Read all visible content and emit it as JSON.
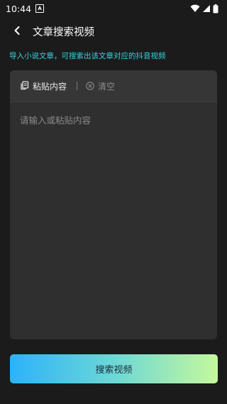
{
  "status_bar": {
    "time": "10:44",
    "notification_badge": "A",
    "icons": [
      "wifi-icon",
      "signal-icon",
      "battery-icon"
    ]
  },
  "header": {
    "back_icon": "chevron-left-icon",
    "title": "文章搜索视频"
  },
  "hint": "导入小说文章，可搜索出该文章对应的抖音视频",
  "toolbar": {
    "paste_icon": "copy-icon",
    "paste_label": "粘贴内容",
    "clear_icon": "close-circle-icon",
    "clear_label": "清空"
  },
  "input": {
    "value": "",
    "placeholder": "请输入或粘贴内容"
  },
  "search_button": {
    "label": "搜索视频"
  },
  "colors": {
    "background": "#1b1b1b",
    "panel": "#2f2f2f",
    "hint": "#34d6e0",
    "gradient_start": "#2bb3f9",
    "gradient_end": "#c5f89c"
  }
}
